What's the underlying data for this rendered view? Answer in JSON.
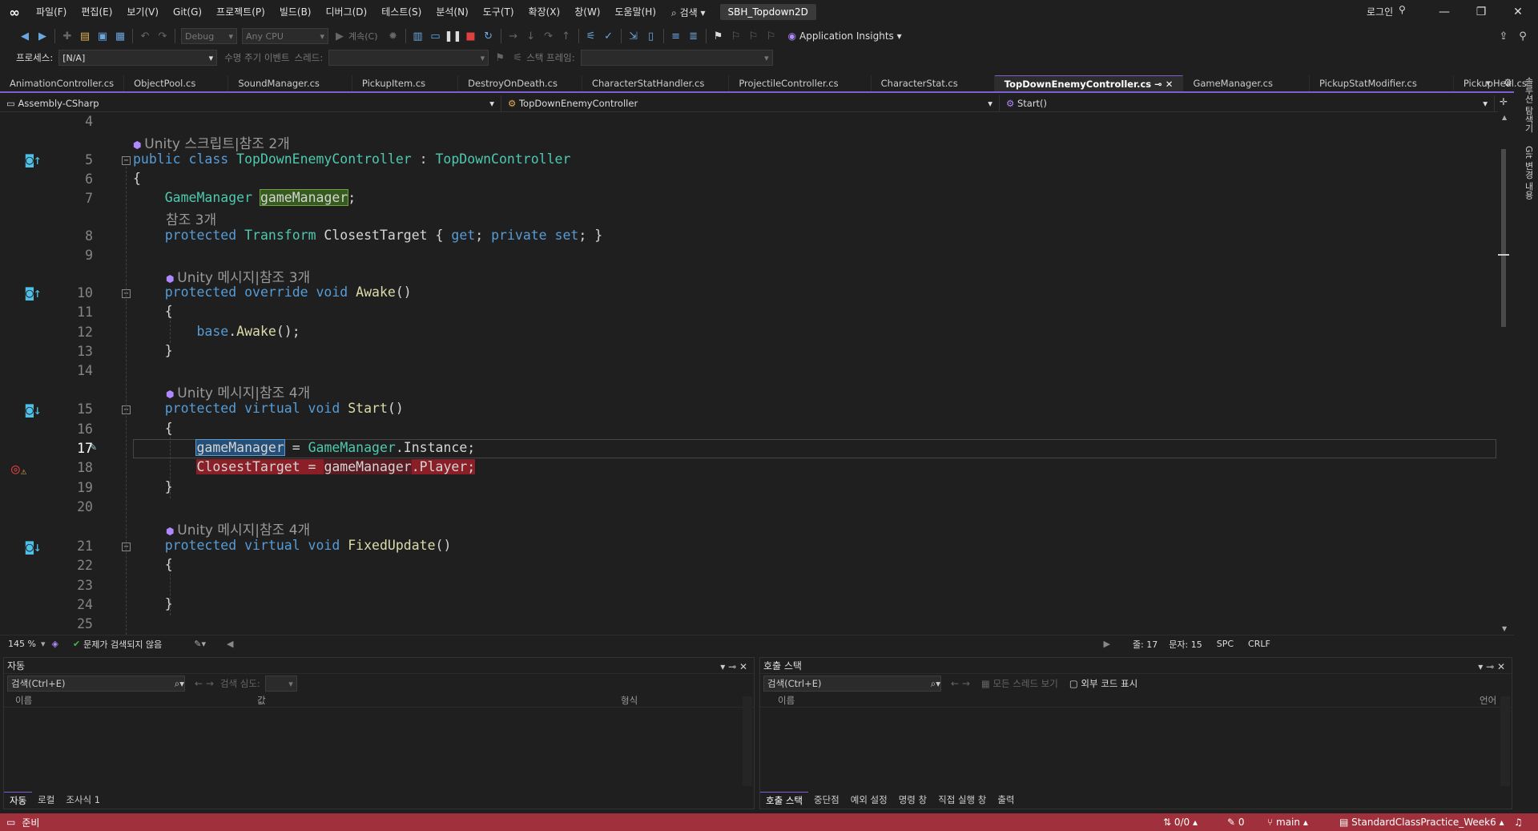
{
  "menu": [
    "파일(F)",
    "편집(E)",
    "보기(V)",
    "Git(G)",
    "프로젝트(P)",
    "빌드(B)",
    "디버그(D)",
    "테스트(S)",
    "분석(N)",
    "도구(T)",
    "확장(X)",
    "창(W)",
    "도움말(H)"
  ],
  "search_label": "검색",
  "solution_name": "SBH_Topdown2D",
  "login_label": "로그인",
  "toolbar": {
    "config": "Debug",
    "platform": "Any CPU",
    "continue_label": "계속(C)",
    "app_insights": "Application Insights",
    "process_label": "프로세스:",
    "process_value": "[N/A]",
    "lifecycle_label": "수명 주기 이벤트",
    "thread_label": "스레드:",
    "stack_frame_label": "스택 프레임:"
  },
  "tabs": [
    "AnimationController.cs",
    "ObjectPool.cs",
    "SoundManager.cs",
    "PickupItem.cs",
    "DestroyOnDeath.cs",
    "CharacterStatHandler.cs",
    "ProjectileController.cs",
    "CharacterStat.cs",
    "TopDownEnemyController.cs",
    "GameManager.cs",
    "PickupStatModifier.cs",
    "PickupHeal.cs"
  ],
  "active_tab": "TopDownEnemyController.cs",
  "nav": {
    "project": "Assembly-CSharp",
    "type": "TopDownEnemyController",
    "member": "Start()"
  },
  "code": {
    "lens1": "Unity 스크립트|참조 2개",
    "refs3": "참조 3개",
    "lens2": "Unity 메시지|참조 3개",
    "lens3": "Unity 메시지|참조 4개",
    "lens4": "Unity 메시지|참조 4개",
    "lines": [
      "4",
      "5",
      "6",
      "7",
      "8",
      "9",
      "10",
      "11",
      "12",
      "13",
      "14",
      "15",
      "16",
      "17",
      "18",
      "19",
      "20",
      "21",
      "22",
      "23",
      "24",
      "25"
    ]
  },
  "editor_status": {
    "zoom": "145 %",
    "issues": "문제가 검색되지 않음",
    "line": "줄: 17",
    "col": "문자: 15",
    "spc": "SPC",
    "crlf": "CRLF"
  },
  "autos_panel": {
    "title": "자동",
    "search": "검색(Ctrl+E)",
    "depth_label": "검색 심도:",
    "cols": [
      "이름",
      "값",
      "형식"
    ],
    "tabs": [
      "자동",
      "로컬",
      "조사식 1"
    ]
  },
  "callstack_panel": {
    "title": "호출 스택",
    "search": "검색(Ctrl+E)",
    "all_threads": "모든 스레드 보기",
    "external": "외부 코드 표시",
    "cols": [
      "이름",
      "언어"
    ],
    "tabs": [
      "호출 스택",
      "중단점",
      "예외 설정",
      "명령 창",
      "직접 실행 창",
      "출력"
    ]
  },
  "statusbar": {
    "ready": "준비",
    "updown": "0/0",
    "pencil": "0",
    "branch": "main",
    "repo": "StandardClassPractice_Week6"
  },
  "side_tabs": [
    "솔루션 탐색기",
    "Git 변경 내용"
  ]
}
